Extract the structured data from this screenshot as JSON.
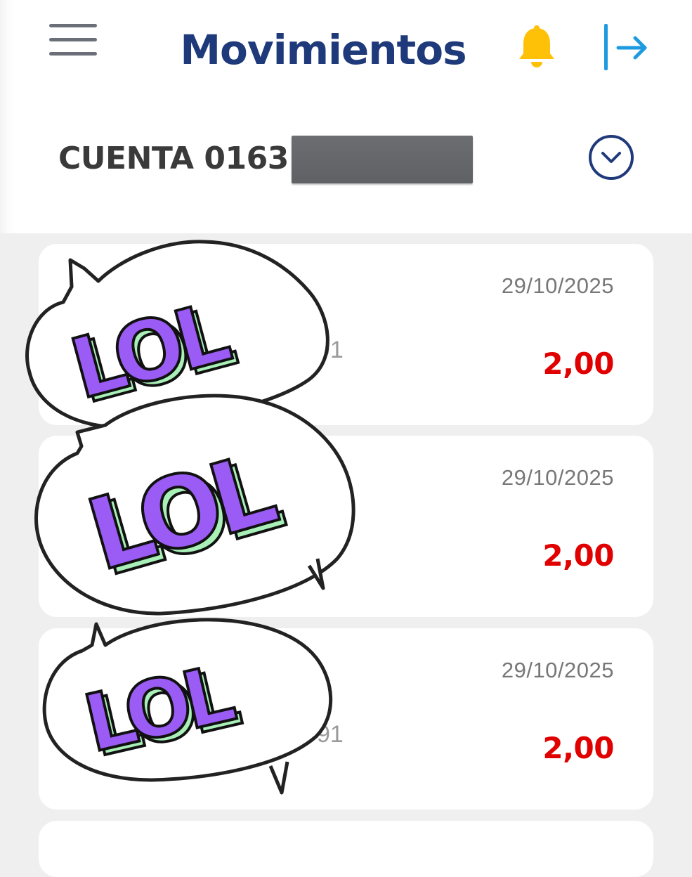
{
  "header": {
    "title": "Movimientos",
    "icons": {
      "menu": "hamburger-menu-icon",
      "notifications": "bell-icon",
      "logout": "logout-arrow-icon"
    },
    "colors": {
      "title": "#1f3a7a",
      "bell": "#ffc107",
      "logout": "#1e9be0"
    }
  },
  "account": {
    "label": "CUENTA 0163",
    "number_masked": true,
    "selector_icon": "chevron-down-circle-icon"
  },
  "transactions": [
    {
      "date": "29/10/2025",
      "amount": "2,00",
      "description_fragment": "91"
    },
    {
      "date": "29/10/2025",
      "amount": "2,00",
      "description_fragment": ""
    },
    {
      "date": "29/10/2025",
      "amount": "2,00",
      "description_fragment": "91"
    }
  ],
  "overlay": {
    "sticker_text": "LOL",
    "colors": {
      "letters": "#9b5cf6",
      "shadow": "#a8f0b8"
    }
  }
}
